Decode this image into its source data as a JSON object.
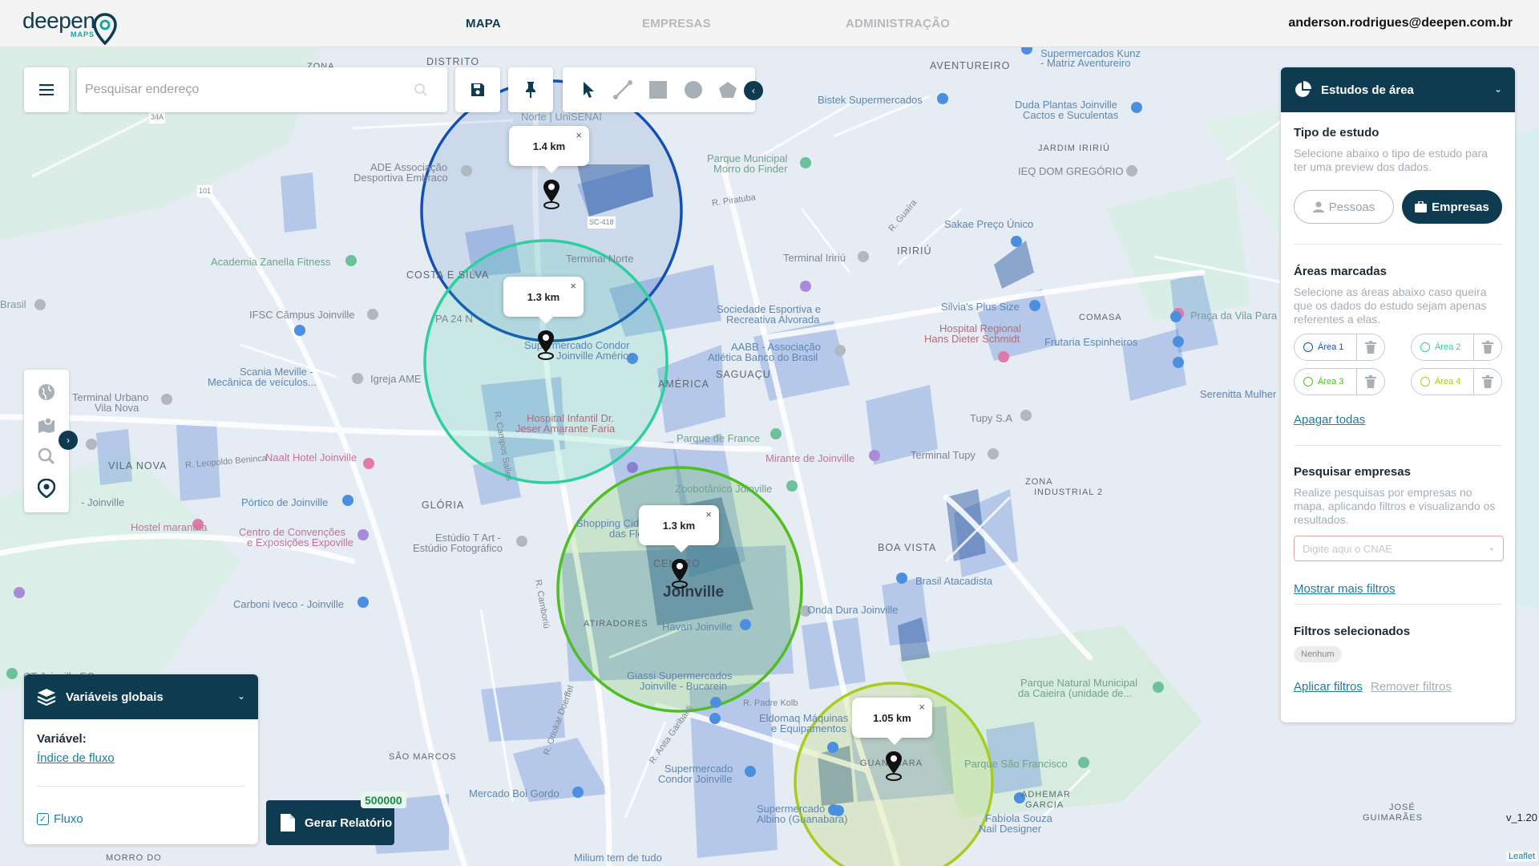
{
  "logo": {
    "word": "deepen",
    "sub": "MAPS"
  },
  "nav": {
    "map": "MAPA",
    "companies": "EMPRESAS",
    "admin": "ADMINISTRAÇÃO"
  },
  "user": {
    "email": "anderson.rodrigues@deepen.com.br"
  },
  "search": {
    "placeholder": "Pesquisar endereço"
  },
  "map": {
    "labels": {
      "distrito": "DISTRITO",
      "zona": "ZONA",
      "aventureiro": "AVENTUREIRO",
      "costa_silva": "COSTA E SILVA",
      "iririu": "IRIRIÚ",
      "america": "AMÉRICA",
      "saguacu": "SAGUAÇU",
      "vila_nova": "VILA NOVA",
      "gloria": "GLÓRIA",
      "centro": "CENTRO",
      "joinville": "Joinville",
      "atiradores": "ATIRADORES",
      "boa_vista": "BOA VISTA",
      "zona_industrial": "ZONA",
      "zona_industrial_2": "INDUSTRIAL 2",
      "sao_marcos": "SÃO MARCOS",
      "guanabara": "GUANABARA",
      "adhemar": "ADHEMAR",
      "garcia": "GARCIA",
      "jardim_iririu": "JARDIM IRIRIÚ",
      "comasa": "COMASA",
      "jose_guimaraes": "JOSÉ",
      "jose_guimaraes_2": "GUIMARÃES",
      "morro": "MORRO DO",
      "brasil": "Brasil",
      "nor": "Norte | UniSENAI",
      "supermercados_kunz": "Supermercados Kunz",
      "matriz_aventureiro": "- Matriz Aventureiro",
      "bistek": "Bistek Supermercados",
      "duda": "Duda Plantas Joinville",
      "cactos": "Cactos e Suculentas",
      "ade": "ADE Associação",
      "ade2": "Desportiva Embraco",
      "parque_finder": "Parque Municipal",
      "parque_finder2": "Morro do Finder",
      "ieq": "IEQ DOM GREGÓRIO",
      "academia": "Academia Zanella Fitness",
      "sakae": "Sakae Preço Único",
      "terminal_norte": "Terminal Norte",
      "terminal_iririu": "Terminal Iririú",
      "ifsc": "IFSC Câmpus Joinville",
      "silvias": "Silvia's Plus Size",
      "hospital_regional": "Hospital Regional",
      "hospital_regional2": "Hans Dieter Schmidt",
      "praca_vila_para": "Praça da Vila Para",
      "sociedade": "Sociedade Esportiva e",
      "sociedade2": "Recreativa Alvorada",
      "frutaria": "Frutaria Espinheiros",
      "scania": "Scania Meville -",
      "scania2": "Mecânica de veículos...",
      "igreja": "Igreja AME",
      "aabb": "AABB - Associação",
      "aabb2": "Atlética Banco do Brasil",
      "supermercado_condor": "Supermercado Condor",
      "supermercado_condor2": "Joinville América",
      "terminal_urbano": "Terminal Urbano",
      "terminal_urbano2": "Vila Nova",
      "hospital_infantil": "Hospital Infantil Dr.",
      "hospital_infantil2": "Jeser Amarante Faria",
      "serenitta": "Serenitta Mulher",
      "tupy_sa": "Tupy S.A",
      "parque_franca": "Parque de France",
      "naalt": "Naalt Hotel Joinville",
      "mirante": "Mirante de Joinville",
      "terminal_tupy": "Terminal Tupy",
      "portico": "Pórtico de Joinville",
      "zoobotanico": "Zoobotânico Joinville",
      "hostel": "Hostel maranata",
      "centro_convencoes": "Centro de Convenções",
      "centro_convencoes2": "e Exposições Expoville",
      "estudio": "Estúdio T Art -",
      "estudio2": "Estúdio Fotográfico",
      "shopping": "Shopping Cidade",
      "shopping2": "das Flores",
      "brasil_atacadista": "Brasil Atacadista",
      "carboni": "Carboni Iveco - Joinville",
      "onda_dura": "Onda Dura Joinville",
      "havan": "Havan Joinville",
      "giassi": "Giassi Supermercados",
      "giassi2": "Joinville - Bucarein",
      "parque_caieira": "Parque Natural Municipal",
      "parque_caieira2": "da Caieira (unidade de...",
      "eldomaq": "Eldomaq Máquinas",
      "eldomaq2": "e Equipamentos",
      "parque_sao_francisco": "Parque São Francisco",
      "supermercado_condor_j": "Supermercado",
      "supermercado_condor_j2": "Condor Joinville",
      "mercado_boi": "Mercado Boi Gordo",
      "supermercado_albino": "Supermercado",
      "supermercado_albino2": "Albino (Guanabara)",
      "fabiola": "Fabíola Souza",
      "fabiola2": "Nail Designer",
      "milium": "Milium tem de tudo",
      "vila_nova_2": "- Joinville",
      "ct": "CT Joinville EC",
      "piratuba": "R. Piratuba",
      "padre_kolb": "R. Padre Kolb",
      "anita": "R. Anita Garibaldi",
      "ottokar": "R. Ottokar Doerffel",
      "leopoldo": "R. Leopoldo Beninca",
      "camboriu": "R. Camboriú",
      "campos_salles": "R. Campos Salles",
      "guaira": "R. Guaíra",
      "sc418": "SC-418",
      "r101": "101",
      "r34a": "34A",
      "pa24": "PA 24 N"
    },
    "circles": [
      {
        "area": "Área 1",
        "distance": "1.4 km",
        "color": "#1250b5"
      },
      {
        "area": "Área 2",
        "distance": "1.3 km",
        "color": "#2ccf9e"
      },
      {
        "area": "Área 3",
        "distance": "1.3 km",
        "color": "#4ebf22"
      },
      {
        "area": "Área 4",
        "distance": "1.05 km",
        "color": "#a8cc1d"
      }
    ],
    "close_glyph": "×"
  },
  "tools": {
    "menu_icon": "menu-icon",
    "save_icon": "save-icon",
    "pin_icon": "pin-icon",
    "cursor_icon": "cursor-icon",
    "line_icon": "line-icon",
    "rect_icon": "rectangle-icon",
    "circle_icon": "circle-icon",
    "polygon_icon": "polygon-icon",
    "collapse_glyph": "‹"
  },
  "left_tools": {
    "expand_glyph": "›"
  },
  "panel": {
    "title": "Estudos de área",
    "study_type_title": "Tipo de estudo",
    "study_type_desc": "Selecione abaixo o tipo de estudo para ter uma preview dos dados.",
    "btn_people": "Pessoas",
    "btn_companies": "Empresas",
    "marked_areas_title": "Áreas marcadas",
    "marked_areas_desc": "Selecione as áreas abaixo caso queira que os dados do estudo sejam apenas referentes a elas.",
    "areas": [
      {
        "name": "Área 1",
        "color": "#1250b5"
      },
      {
        "name": "Área 2",
        "color": "#2ccf9e"
      },
      {
        "name": "Área 3",
        "color": "#4ebf22"
      },
      {
        "name": "Área 4",
        "color": "#a8cc1d"
      }
    ],
    "delete_all": "Apagar todas",
    "search_companies_title": "Pesquisar empresas",
    "search_companies_desc": "Realize pesquisas por empresas no mapa, aplicando filtros e visualizando os resultados.",
    "cnae_placeholder": "Digite aqui o CNAE",
    "more_filters": "Mostrar mais filtros",
    "selected_filters_title": "Filtros selecionados",
    "selected_filters_chip": "Nenhum",
    "apply_filters": "Aplicar filtros",
    "remove_filters": "Remover filtros",
    "chevron_glyph": "⌄"
  },
  "global_vars": {
    "title": "Variáveis globais",
    "variable_label": "Variável:",
    "variable_value": "Índice de fluxo",
    "checkbox_label": "Fluxo",
    "check_glyph": "✓"
  },
  "report": {
    "label": "Gerar Relatório",
    "badge": "500000"
  },
  "footer": {
    "version": "v_1.20",
    "attribution": "Leaflet"
  }
}
